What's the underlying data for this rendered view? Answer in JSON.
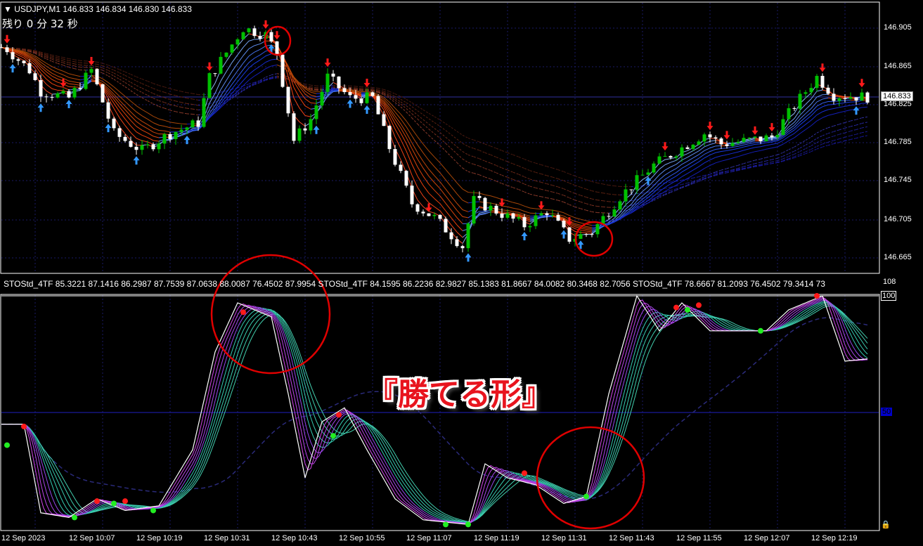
{
  "symbol_header": {
    "collapse_icon": "triangle-down-icon",
    "text": "USDJPY,M1  146.833 146.834 146.830 146.833"
  },
  "timer": {
    "text": "残り 0 分 32 秒"
  },
  "price_axis": {
    "labels": [
      "146.905",
      "146.865",
      "146.825",
      "146.785",
      "146.745",
      "146.705",
      "146.665"
    ],
    "current_price": "146.833"
  },
  "indicator_header": {
    "text": "STOStd_4TF 85.3221 87.1416 86.2987 87.7539 87.0638 88.0087 76.4502 87.9954  STOStd_4TF 84.1595 86.2236 82.9827 85.1383 81.8667 84.0082 80.3468 82.7056  STOStd_4TF 78.6667 81.2093 76.4502 79.3414 73"
  },
  "indicator_axis": {
    "max": "108",
    "level_100": "100",
    "level_50": "50"
  },
  "time_axis": {
    "labels": [
      "12 Sep 2023",
      "12 Sep 10:07",
      "12 Sep 10:19",
      "12 Sep 10:31",
      "12 Sep 10:43",
      "12 Sep 10:55",
      "12 Sep 11:07",
      "12 Sep 11:19",
      "12 Sep 11:31",
      "12 Sep 11:43",
      "12 Sep 11:55",
      "12 Sep 12:07",
      "12 Sep 12:19"
    ]
  },
  "annotation": "『勝てる形』",
  "colors": {
    "bull": "#00c000",
    "bear": "#ffffff",
    "sell_arrow": "#ff1a1a",
    "buy_arrow": "#3399ff",
    "highlight": "#e00000"
  },
  "chart_data": {
    "type": "candlestick",
    "timeframe": "M1",
    "price_waypoints_minute_price": [
      [
        -5,
        146.885
      ],
      [
        -4,
        146.883
      ],
      [
        0,
        146.861
      ],
      [
        2,
        146.839
      ],
      [
        7,
        146.832
      ],
      [
        11,
        146.861
      ],
      [
        15,
        146.795
      ],
      [
        20,
        146.777
      ],
      [
        25,
        146.795
      ],
      [
        30,
        146.806
      ],
      [
        32,
        146.854
      ],
      [
        38,
        146.905
      ],
      [
        42,
        146.898
      ],
      [
        44,
        146.879
      ],
      [
        47,
        146.788
      ],
      [
        50,
        146.81
      ],
      [
        53,
        146.854
      ],
      [
        57,
        146.832
      ],
      [
        61,
        146.832
      ],
      [
        64,
        146.78
      ],
      [
        68,
        146.722
      ],
      [
        72,
        146.707
      ],
      [
        77,
        146.677
      ],
      [
        79,
        146.725
      ],
      [
        83,
        146.714
      ],
      [
        88,
        146.699
      ],
      [
        92,
        146.714
      ],
      [
        96,
        146.685
      ],
      [
        100,
        146.692
      ],
      [
        105,
        146.729
      ],
      [
        111,
        146.762
      ],
      [
        116,
        146.78
      ],
      [
        120,
        146.795
      ],
      [
        123,
        146.784
      ],
      [
        127,
        146.787
      ],
      [
        132,
        146.791
      ],
      [
        136,
        146.824
      ],
      [
        140,
        146.854
      ],
      [
        143,
        146.835
      ],
      [
        149,
        146.833
      ]
    ],
    "sell_signals_minute": [
      -4,
      6,
      11,
      32,
      42,
      44,
      53,
      60,
      71,
      84,
      91,
      96,
      113,
      121,
      124,
      129,
      132,
      141,
      148
    ],
    "buy_signals_minute": [
      -3,
      2,
      7,
      14,
      19,
      28,
      43,
      51,
      57,
      60,
      78,
      88,
      95,
      98,
      110,
      147
    ],
    "stochastic_waypoints_minute_value": [
      [
        -5,
        45
      ],
      [
        -1,
        45
      ],
      [
        2,
        7
      ],
      [
        7,
        5
      ],
      [
        12,
        13
      ],
      [
        17,
        8
      ],
      [
        23,
        10
      ],
      [
        29,
        34
      ],
      [
        33,
        76
      ],
      [
        37,
        97
      ],
      [
        43,
        91
      ],
      [
        46,
        58
      ],
      [
        49,
        22
      ],
      [
        52,
        46
      ],
      [
        56,
        52
      ],
      [
        60,
        34
      ],
      [
        65,
        13
      ],
      [
        70,
        4
      ],
      [
        78,
        2
      ],
      [
        81,
        28
      ],
      [
        85,
        22
      ],
      [
        90,
        19
      ],
      [
        95,
        11
      ],
      [
        99,
        14
      ],
      [
        103,
        58
      ],
      [
        108,
        100
      ],
      [
        112,
        85
      ],
      [
        116,
        97
      ],
      [
        121,
        85
      ],
      [
        126,
        85
      ],
      [
        131,
        85
      ],
      [
        135,
        94
      ],
      [
        141,
        100
      ],
      [
        145,
        72
      ],
      [
        149,
        73
      ]
    ],
    "stochastic_red_dots": [
      [
        -1,
        44
      ],
      [
        12,
        12
      ],
      [
        17,
        12
      ],
      [
        38,
        93
      ],
      [
        55,
        49
      ],
      [
        88,
        24
      ],
      [
        115,
        95
      ],
      [
        119,
        96
      ],
      [
        140,
        100
      ]
    ],
    "stochastic_green_dots": [
      [
        -4,
        36
      ],
      [
        8,
        5
      ],
      [
        15,
        11
      ],
      [
        22,
        8
      ],
      [
        54,
        40
      ],
      [
        74,
        2
      ],
      [
        78,
        2
      ],
      [
        99,
        14
      ],
      [
        117,
        94
      ],
      [
        130,
        85
      ]
    ],
    "levels": [
      50,
      100
    ],
    "y_range": [
      0,
      108
    ],
    "price_range": [
      146.655,
      146.925
    ]
  }
}
